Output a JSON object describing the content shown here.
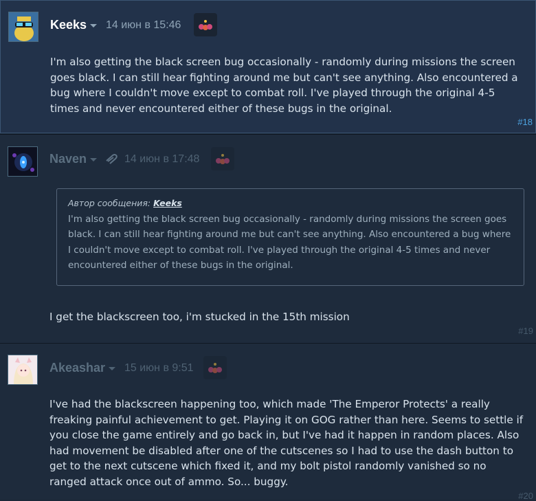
{
  "posts": [
    {
      "author": "Keeks",
      "date": "14 июн в 15:46",
      "text": "I'm also getting the black screen bug occasionally - randomly during missions the screen goes black. I can still hear fighting around me but can't see anything. Also encountered a bug where I couldn't move except to combat roll. I've played through the original 4-5 times and never encountered either of these bugs in the original.",
      "number": "#18"
    },
    {
      "author": "Naven",
      "date": "14 июн в 17:48",
      "quote_prefix": "Автор сообщения:",
      "quote_author": "Keeks",
      "quote_text": "I'm also getting the black screen bug occasionally - randomly during missions the screen goes black. I can still hear fighting around me but can't see anything. Also encountered a bug where I couldn't move except to combat roll. I've played through the original 4-5 times and never encountered either of these bugs in the original.",
      "text": "I get the blackscreen too, i'm stucked in the 15th mission",
      "number": "#19"
    },
    {
      "author": "Akeashar",
      "date": "15 июн в 9:51",
      "text": "I've had the blackscreen happening too, which made 'The Emperor Protects' a really freaking painful achievement to get. Playing it on GOG rather than here. Seems to settle if you close the game entirely and go back in, but I've had it happen in random places. Also had movement be disabled after one of the cutscenes so I had to use the dash button to get to the next cutscene which fixed it, and my bolt pistol randomly vanished so no ranged attack once out of ammo. So... buggy.",
      "number": "#20"
    }
  ],
  "colors": {
    "background": "#1b2838",
    "post_bg": "#1e2b3c",
    "highlight_bg": "#22324a",
    "link_blue": "#4da3e0",
    "text": "#d9e3ec"
  },
  "icons": [
    "caret-down-icon",
    "badge-icon",
    "paperclip-icon"
  ]
}
